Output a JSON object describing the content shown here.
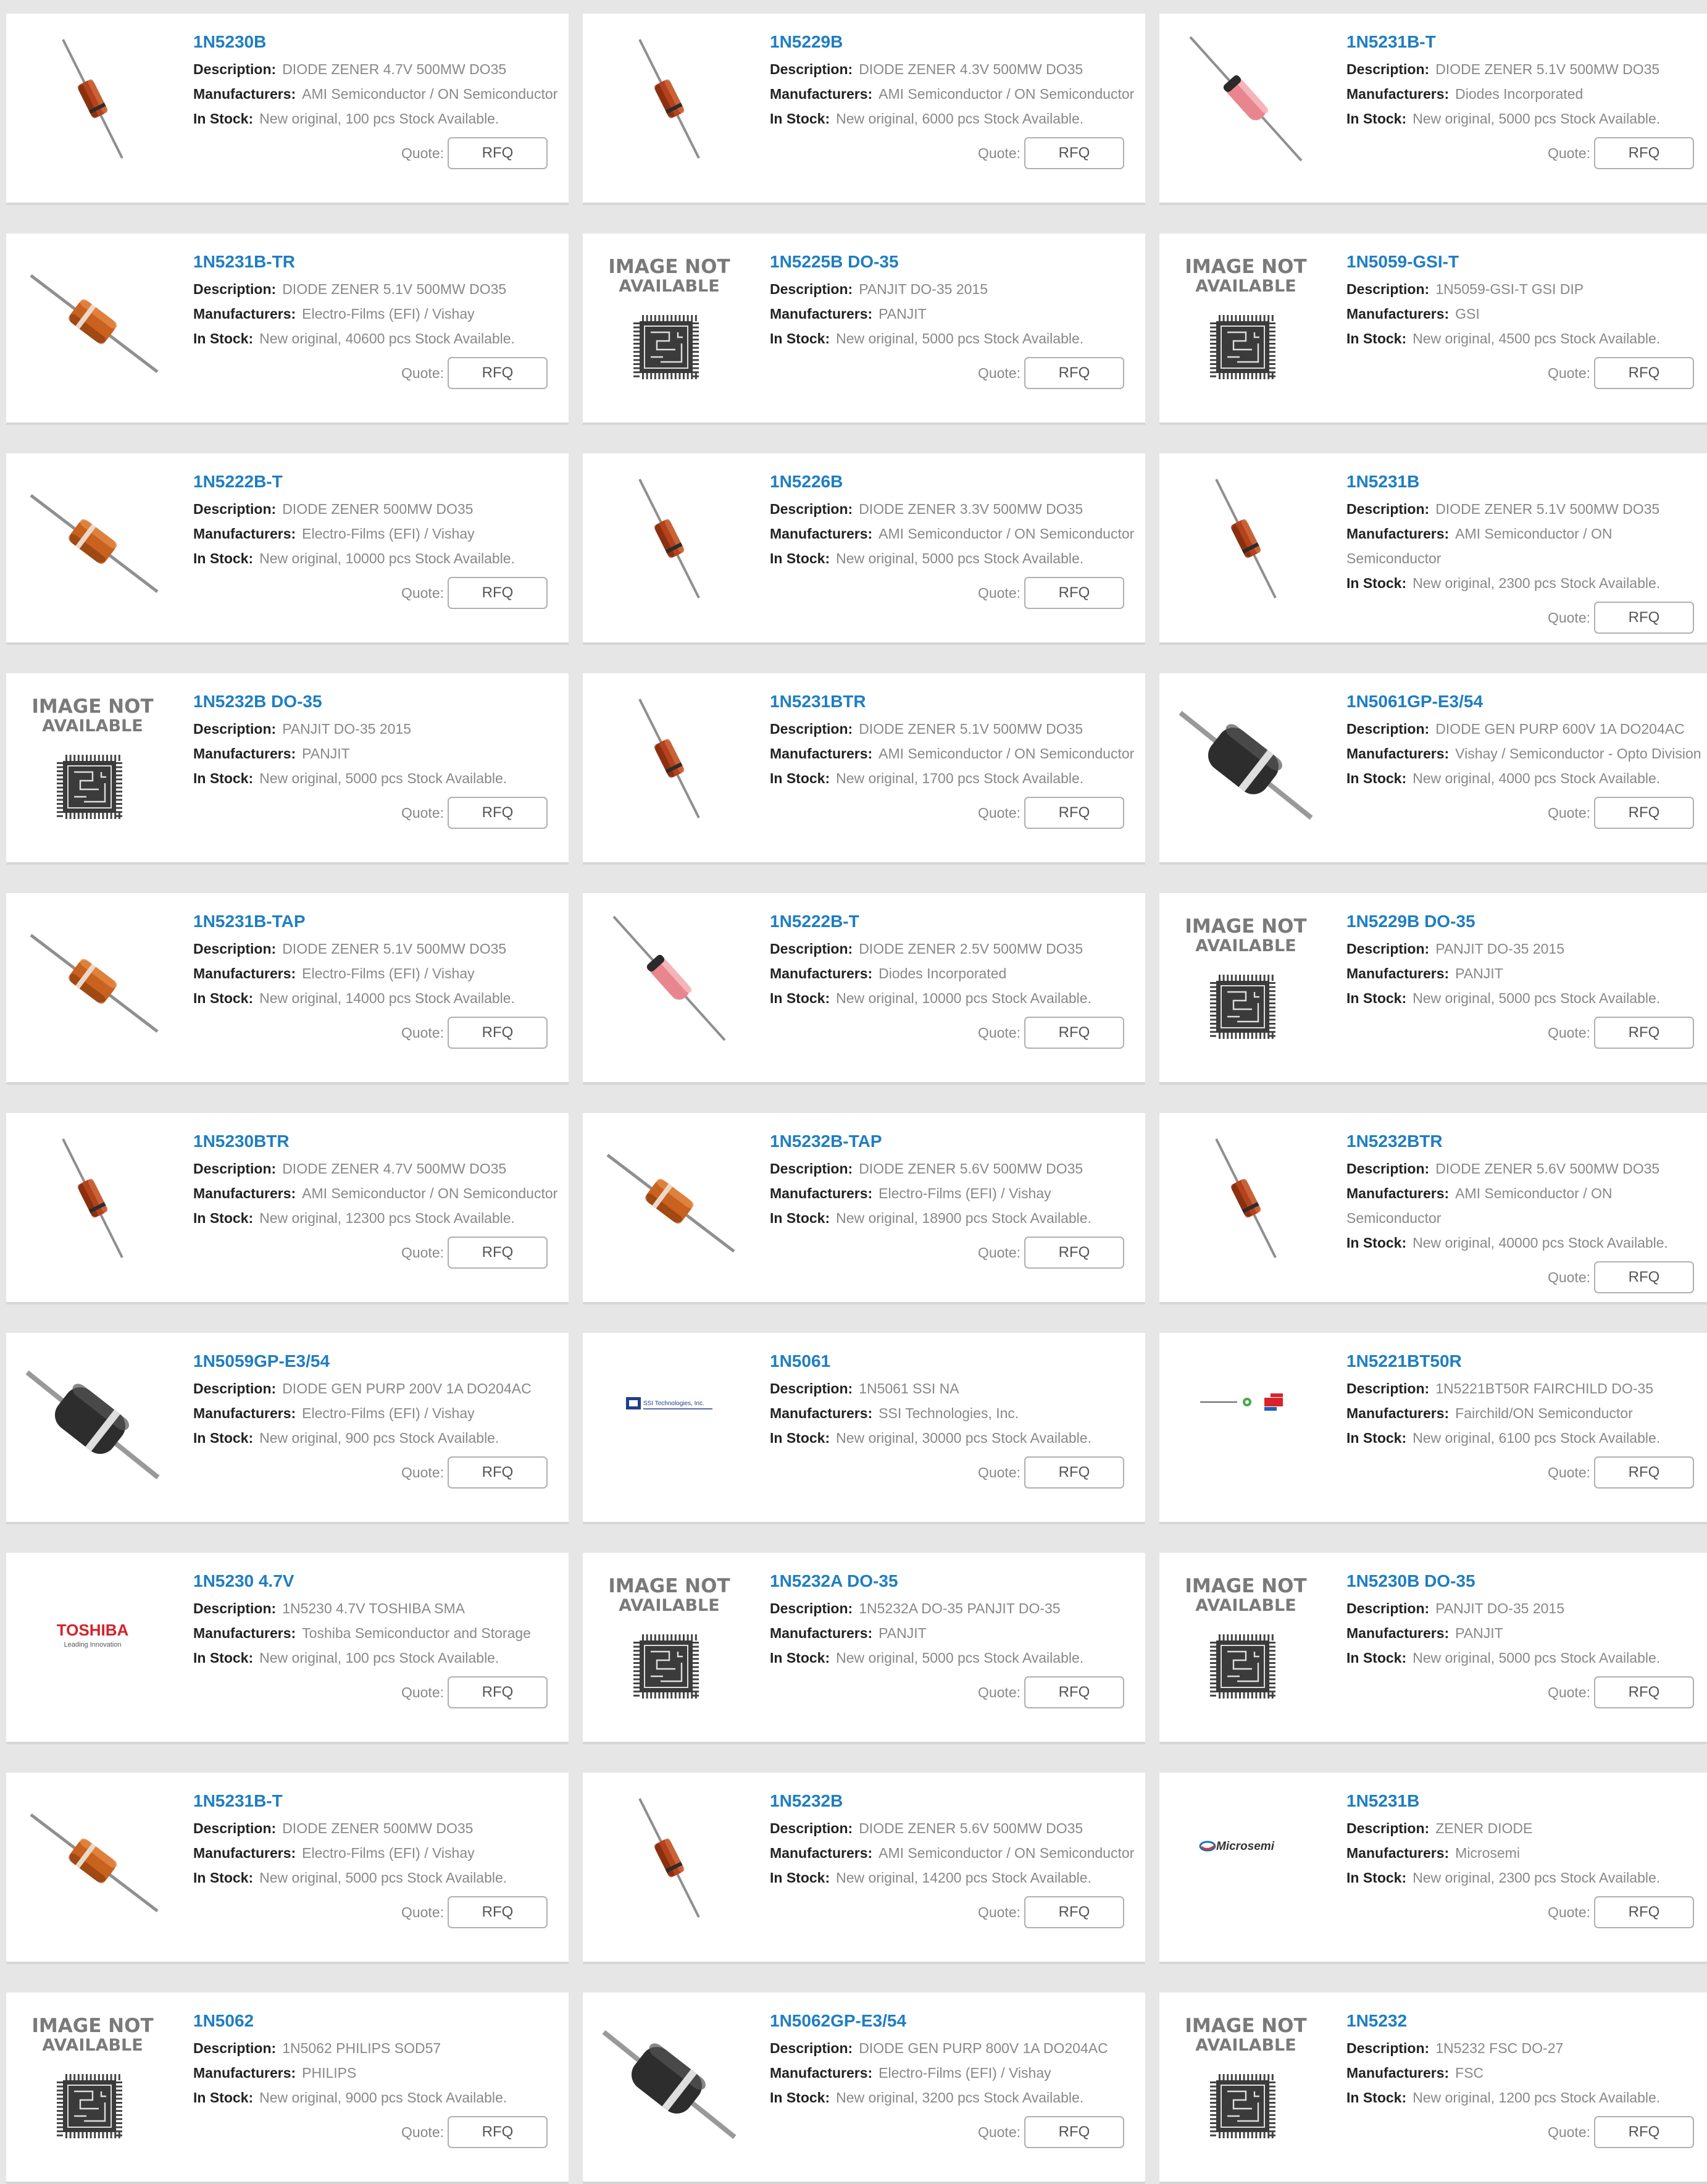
{
  "labels": {
    "description": "Description:",
    "manufacturers": "Manufacturers:",
    "in_stock": "In Stock:",
    "quote": "Quote:",
    "rfq": "RFQ"
  },
  "placeholder_image": {
    "line1": "IMAGE NOT",
    "line2": "AVAILABLE"
  },
  "logos": {
    "toshiba": "TOSHIBA",
    "toshiba_tagline": "Leading Innovation",
    "microsemi": "Microsemi",
    "ssi": "SSI Technologies, Inc."
  },
  "colors": {
    "part_number": "#1f7ec2",
    "page_bg": "#e6e6e6",
    "card_bg": "#ffffff"
  },
  "products": [
    {
      "part": "1N5230B",
      "description": "DIODE ZENER 4.7V 500MW DO35",
      "manufacturer": "AMI Semiconductor / ON Semiconductor",
      "stock": "New original, 100 pcs Stock Available.",
      "image": "diode-steep"
    },
    {
      "part": "1N5229B",
      "description": "DIODE ZENER 4.3V 500MW DO35",
      "manufacturer": "AMI Semiconductor / ON Semiconductor",
      "stock": "New original, 6000 pcs Stock Available.",
      "image": "diode-steep"
    },
    {
      "part": "1N5231B-T",
      "description": "DIODE ZENER 5.1V 500MW DO35",
      "manufacturer": "Diodes Incorporated",
      "stock": "New original, 5000 pcs Stock Available.",
      "image": "diode-glass"
    },
    {
      "part": "1N5231B-TR",
      "description": "DIODE ZENER 5.1V 500MW DO35",
      "manufacturer": "Electro-Films (EFI) / Vishay",
      "stock": "New original, 40600 pcs Stock Available.",
      "image": "diode-orange"
    },
    {
      "part": "1N5225B DO-35",
      "description": "PANJIT DO-35 2015",
      "manufacturer": "PANJIT",
      "stock": "New original, 5000 pcs Stock Available.",
      "image": "not-available"
    },
    {
      "part": "1N5059-GSI-T",
      "description": "1N5059-GSI-T GSI DIP",
      "manufacturer": "GSI",
      "stock": "New original, 4500 pcs Stock Available.",
      "image": "not-available"
    },
    {
      "part": "1N5222B-T",
      "description": "DIODE ZENER 500MW DO35",
      "manufacturer": "Electro-Films (EFI) / Vishay",
      "stock": "New original, 10000 pcs Stock Available.",
      "image": "diode-orange"
    },
    {
      "part": "1N5226B",
      "description": "DIODE ZENER 3.3V 500MW DO35",
      "manufacturer": "AMI Semiconductor / ON Semiconductor",
      "stock": "New original, 5000 pcs Stock Available.",
      "image": "diode-steep"
    },
    {
      "part": "1N5231B",
      "description": "DIODE ZENER 5.1V 500MW DO35",
      "manufacturer": "AMI Semiconductor / ON Semiconductor",
      "stock": "New original, 2300 pcs Stock Available.",
      "image": "diode-steep"
    },
    {
      "part": "1N5232B DO-35",
      "description": "PANJIT DO-35 2015",
      "manufacturer": "PANJIT",
      "stock": "New original, 5000 pcs Stock Available.",
      "image": "not-available"
    },
    {
      "part": "1N5231BTR",
      "description": "DIODE ZENER 5.1V 500MW DO35",
      "manufacturer": "AMI Semiconductor / ON Semiconductor",
      "stock": "New original, 1700 pcs Stock Available.",
      "image": "diode-steep"
    },
    {
      "part": "1N5061GP-E3/54",
      "description": "DIODE GEN PURP 600V 1A DO204AC",
      "manufacturer": "Vishay / Semiconductor - Opto Division",
      "stock": "New original, 4000 pcs Stock Available.",
      "image": "diode-black"
    },
    {
      "part": "1N5231B-TAP",
      "description": "DIODE ZENER 5.1V 500MW DO35",
      "manufacturer": "Electro-Films (EFI) / Vishay",
      "stock": "New original, 14000 pcs Stock Available.",
      "image": "diode-orange"
    },
    {
      "part": "1N5222B-T",
      "description": "DIODE ZENER 2.5V 500MW DO35",
      "manufacturer": "Diodes Incorporated",
      "stock": "New original, 10000 pcs Stock Available.",
      "image": "diode-glass"
    },
    {
      "part": "1N5229B DO-35",
      "description": "PANJIT DO-35 2015",
      "manufacturer": "PANJIT",
      "stock": "New original, 5000 pcs Stock Available.",
      "image": "not-available"
    },
    {
      "part": "1N5230BTR",
      "description": "DIODE ZENER 4.7V 500MW DO35",
      "manufacturer": "AMI Semiconductor / ON Semiconductor",
      "stock": "New original, 12300 pcs Stock Available.",
      "image": "diode-steep"
    },
    {
      "part": "1N5232B-TAP",
      "description": "DIODE ZENER 5.6V 500MW DO35",
      "manufacturer": "Electro-Films (EFI) / Vishay",
      "stock": "New original, 18900 pcs Stock Available.",
      "image": "diode-orange"
    },
    {
      "part": "1N5232BTR",
      "description": "DIODE ZENER 5.6V 500MW DO35",
      "manufacturer": "AMI Semiconductor / ON Semiconductor",
      "stock": "New original, 40000 pcs Stock Available.",
      "image": "diode-steep"
    },
    {
      "part": "1N5059GP-E3/54",
      "description": "DIODE GEN PURP 200V 1A DO204AC",
      "manufacturer": "Electro-Films (EFI) / Vishay",
      "stock": "New original, 900 pcs Stock Available.",
      "image": "diode-black"
    },
    {
      "part": "1N5061",
      "description": "1N5061 SSI NA",
      "manufacturer": "SSI Technologies, Inc.",
      "stock": "New original, 30000 pcs Stock Available.",
      "image": "logo-ssi"
    },
    {
      "part": "1N5221BT50R",
      "description": "1N5221BT50R FAIRCHILD DO-35",
      "manufacturer": "Fairchild/ON Semiconductor",
      "stock": "New original, 6100 pcs Stock Available.",
      "image": "logo-fairchild"
    },
    {
      "part": "1N5230 4.7V",
      "description": "1N5230 4.7V TOSHIBA SMA",
      "manufacturer": "Toshiba Semiconductor and Storage",
      "stock": "New original, 100 pcs Stock Available.",
      "image": "logo-toshiba"
    },
    {
      "part": "1N5232A DO-35",
      "description": "1N5232A DO-35 PANJIT DO-35",
      "manufacturer": "PANJIT",
      "stock": "New original, 5000 pcs Stock Available.",
      "image": "not-available"
    },
    {
      "part": "1N5230B DO-35",
      "description": "PANJIT DO-35 2015",
      "manufacturer": "PANJIT",
      "stock": "New original, 5000 pcs Stock Available.",
      "image": "not-available"
    },
    {
      "part": "1N5231B-T",
      "description": "DIODE ZENER 500MW DO35",
      "manufacturer": "Electro-Films (EFI) / Vishay",
      "stock": "New original, 5000 pcs Stock Available.",
      "image": "diode-orange"
    },
    {
      "part": "1N5232B",
      "description": "DIODE ZENER 5.6V 500MW DO35",
      "manufacturer": "AMI Semiconductor / ON Semiconductor",
      "stock": "New original, 14200 pcs Stock Available.",
      "image": "diode-steep"
    },
    {
      "part": "1N5231B",
      "description": "ZENER DIODE",
      "manufacturer": "Microsemi",
      "stock": "New original, 2300 pcs Stock Available.",
      "image": "logo-microsemi"
    },
    {
      "part": "1N5062",
      "description": "1N5062 PHILIPS SOD57",
      "manufacturer": "PHILIPS",
      "stock": "New original, 9000 pcs Stock Available.",
      "image": "not-available"
    },
    {
      "part": "1N5062GP-E3/54",
      "description": "DIODE GEN PURP 800V 1A DO204AC",
      "manufacturer": "Electro-Films (EFI) / Vishay",
      "stock": "New original, 3200 pcs Stock Available.",
      "image": "diode-black"
    },
    {
      "part": "1N5232",
      "description": "1N5232 FSC DO-27",
      "manufacturer": "FSC",
      "stock": "New original, 1200 pcs Stock Available.",
      "image": "not-available"
    }
  ]
}
